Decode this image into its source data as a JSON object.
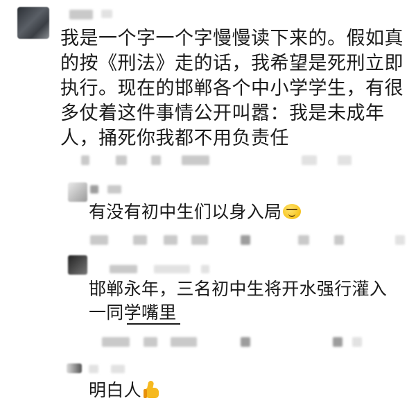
{
  "main_comment": {
    "avatar_icon": "blurred-user-avatar",
    "username": "",
    "lines": [
      "我是一个字一个字慢慢读下来的。假如真",
      "的按《刑法》走的话，我希望是死刑立即",
      "执行。现在的邯郸各个中小学学生，有很",
      "多仗着这件事情公开叫嚣：我是未成年",
      "人，捅死你我都不用负责任"
    ]
  },
  "replies": [
    {
      "avatar_icon": "blurred-user-avatar",
      "text": "有没有初中生们以身入局",
      "emoji": "smirk-face-emoji"
    },
    {
      "avatar_icon": "blurred-user-avatar",
      "lines": [
        "邯郸永年，三名初中生将开水强行灌入",
        "一同学嘴里"
      ]
    },
    {
      "avatar_icon": "blurred-user-avatar",
      "text": "明白人",
      "emoji": "thumbs-up-emoji"
    }
  ],
  "colors": {
    "text": "#1b1b1b",
    "background": "#ffffff",
    "blur_gray": "#c9c9c9"
  }
}
